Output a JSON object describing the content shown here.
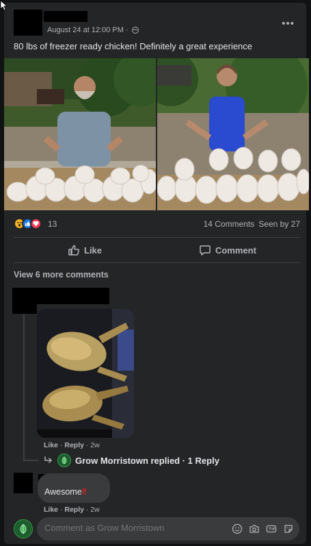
{
  "post": {
    "timestamp": "August 24 at 12:00 PM · ",
    "text": "80 lbs of freezer ready chicken! Definitely a great experience",
    "reaction_count": "13",
    "comments_count": "14 Comments",
    "seen_by": "Seen by 27",
    "like_label": "Like",
    "comment_label": "Comment"
  },
  "comments": {
    "view_more": "View 6 more comments",
    "first": {
      "like": "Like",
      "reply": "Reply",
      "age": "2w",
      "replied_text": "Grow Morristown replied · 1 Reply"
    },
    "second": {
      "text": "Awesome",
      "emoji": "‼",
      "like": "Like",
      "reply": "Reply",
      "age": "2w"
    }
  },
  "composer": {
    "placeholder": "Comment as Grow Morristown"
  },
  "icons": {
    "reactions": [
      "wow-icon",
      "like-icon",
      "love-icon"
    ],
    "composer": [
      "emoji-icon",
      "camera-icon",
      "gif-icon",
      "sticker-icon"
    ]
  },
  "colors": {
    "background": "#242526",
    "bubble": "#3a3b3c",
    "text": "#e4e6eb",
    "muted": "#b0b3b8",
    "brand_green": "#1c5e2c"
  }
}
